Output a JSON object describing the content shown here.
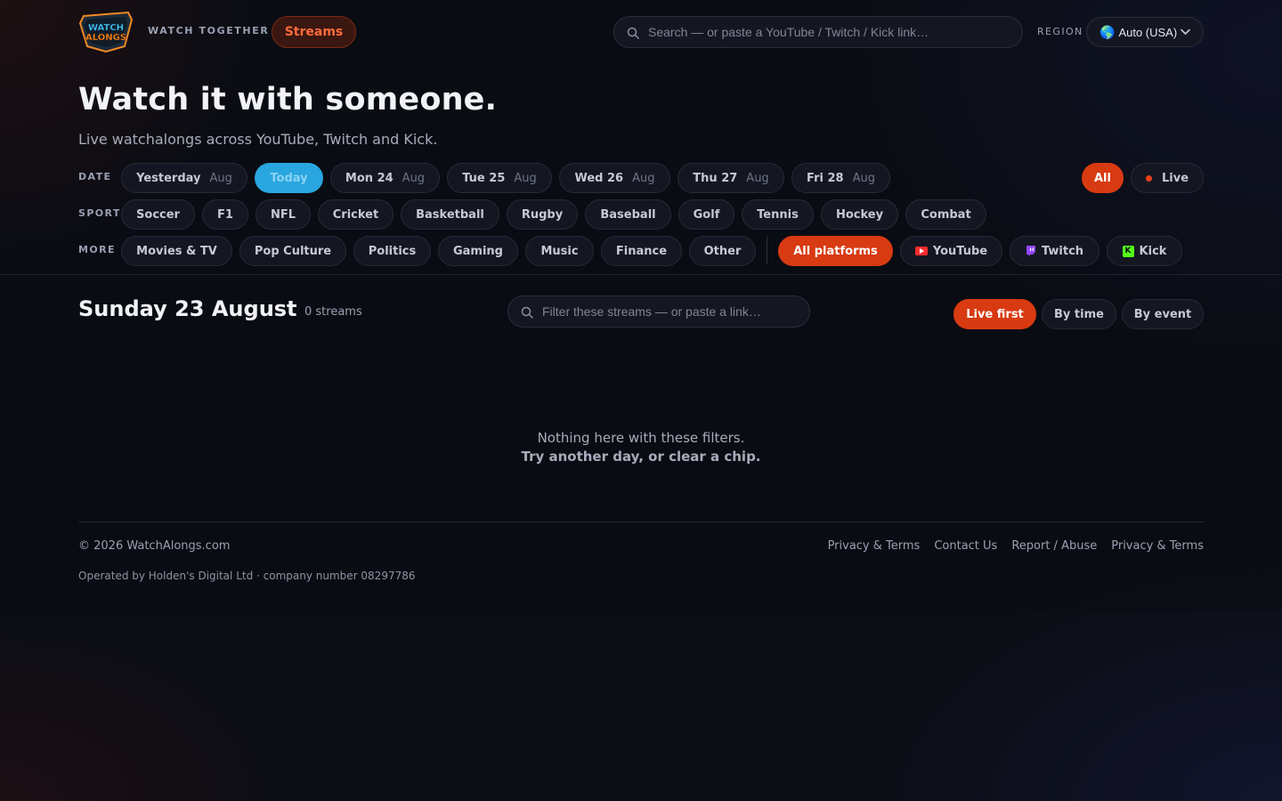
{
  "header": {
    "logo_text": "WATCH ALONGS",
    "brand_tag": "WATCH TOGETHER",
    "streams_label": "Streams",
    "search_placeholder": "Search — or paste a YouTube / Twitch / Kick link…",
    "region_label": "REGION",
    "region_value": "Auto (USA)",
    "region_icon": "globe-icon"
  },
  "hero": {
    "title": "Watch it with someone.",
    "subtitle": "Live watchalongs across YouTube, Twitch and Kick."
  },
  "date_row": {
    "label": "DATE",
    "chips": [
      {
        "day": "Yesterday",
        "month": "Aug"
      },
      {
        "day": "Today",
        "month": ""
      },
      {
        "day": "Mon 24",
        "month": "Aug"
      },
      {
        "day": "Tue 25",
        "month": "Aug"
      },
      {
        "day": "Wed 26",
        "month": "Aug"
      },
      {
        "day": "Thu 27",
        "month": "Aug"
      },
      {
        "day": "Fri 28",
        "month": "Aug"
      }
    ],
    "status_all": "All",
    "status_live": "Live"
  },
  "sport_row": {
    "label": "SPORT",
    "chips": [
      "Soccer",
      "F1",
      "NFL",
      "Cricket",
      "Basketball",
      "Rugby",
      "Baseball",
      "Golf",
      "Tennis",
      "Hockey",
      "Combat"
    ]
  },
  "more_row": {
    "label": "MORE",
    "chips": [
      "Movies & TV",
      "Pop Culture",
      "Politics",
      "Gaming",
      "Music",
      "Finance",
      "Other"
    ],
    "platforms": {
      "all": "All platforms",
      "youtube": "YouTube",
      "twitch": "Twitch",
      "kick": "Kick",
      "kick_glyph": "K"
    }
  },
  "day_section": {
    "title": "Sunday 23 August",
    "count": "0 streams",
    "filter_placeholder": "Filter these streams — or paste a link…",
    "sort": [
      "Live first",
      "By time",
      "By event"
    ]
  },
  "empty_state": {
    "line1": "Nothing here with these filters.",
    "line2": "Try another day, or clear a chip."
  },
  "footer": {
    "copyright": "© 2026 WatchAlongs.com",
    "operated": "Operated by Holden's Digital Ltd · company number 08297786",
    "links": [
      "Privacy & Terms",
      "Contact Us",
      "Report / Abuse",
      "Privacy & Terms"
    ]
  },
  "colors": {
    "accent": "#d83a12",
    "today": "#29a6df",
    "background": "#0b0d14"
  }
}
